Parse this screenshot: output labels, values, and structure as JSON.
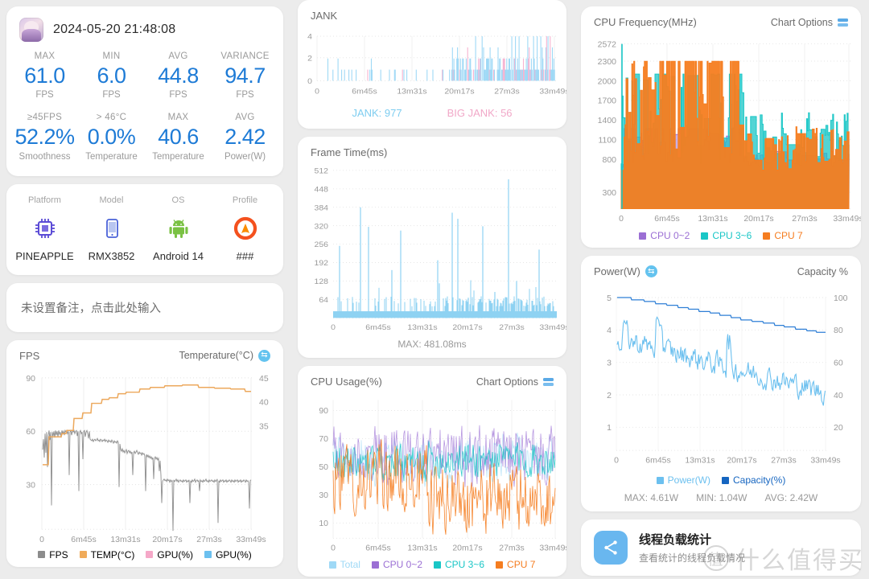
{
  "summary": {
    "date": "2024-05-20 21:48:08",
    "app_icon": "game-app-icon",
    "row1": [
      {
        "top": "MAX",
        "value": "61.0",
        "unit": "FPS"
      },
      {
        "top": "MIN",
        "value": "6.0",
        "unit": "FPS"
      },
      {
        "top": "AVG",
        "value": "44.8",
        "unit": "FPS"
      },
      {
        "top": "VARIANCE",
        "value": "94.7",
        "unit": "FPS"
      }
    ],
    "row2": [
      {
        "top": "≥45FPS",
        "value": "52.2%",
        "unit": "Smoothness"
      },
      {
        "top": "> 46°C",
        "value": "0.0%",
        "unit": "Temperature"
      },
      {
        "top": "MAX",
        "value": "40.6",
        "unit": "Temperature"
      },
      {
        "top": "AVG",
        "value": "2.42",
        "unit": "Power(W)"
      }
    ]
  },
  "device": [
    {
      "label": "Platform",
      "name": "PINEAPPLE",
      "icon": "cpu-chip-icon"
    },
    {
      "label": "Model",
      "name": "RMX3852",
      "icon": "phone-icon"
    },
    {
      "label": "OS",
      "name": "Android 14",
      "icon": "android-icon"
    },
    {
      "label": "Profile",
      "name": "###",
      "icon": "profile-flame-icon"
    }
  ],
  "note": {
    "placeholder": "未设置备注，点击此处输入"
  },
  "colors": {
    "accent_blue": "#1e7bd6",
    "light_blue": "#8ed2f2",
    "pink": "#f5a8c8",
    "purple": "#9b6fd4",
    "teal": "#19c6c6",
    "orange": "#f57d20",
    "orange_light": "#f0ab5a",
    "gray_line": "#8c8c8c",
    "dark_blue": "#1565c0"
  },
  "chart_data": [
    {
      "id": "jank",
      "type": "bar",
      "title": "JANK",
      "ylabel": "",
      "xlabel": "",
      "yticks": [
        0,
        2,
        4
      ],
      "ylim": [
        0,
        4.4
      ],
      "xticks": [
        "0",
        "6m45s",
        "13m31s",
        "20m17s",
        "27m3s",
        "33m49s"
      ],
      "xlim": [
        0,
        2029
      ],
      "grid": true,
      "series": [
        {
          "name": "JANK",
          "color": "#9fd9f6",
          "summary_label": "JANK: 977",
          "value": 977
        },
        {
          "name": "BIG JANK",
          "color": "#f7b3d0",
          "summary_label": "BIG JANK: 56",
          "value": 56
        }
      ],
      "notes": "Sparse low jank bars before ~17m, dense 1-4 jank bars after ~17m"
    },
    {
      "id": "frame_time",
      "type": "bar",
      "title": "Frame Time(ms)",
      "yticks": [
        64,
        128,
        192,
        256,
        320,
        384,
        448,
        512
      ],
      "ylim": [
        0,
        512
      ],
      "xticks": [
        "0",
        "6m45s",
        "13m31s",
        "20m17s",
        "27m3s",
        "33m49s"
      ],
      "grid": true,
      "series": [
        {
          "name": "Frame Time",
          "color": "#8ed2f2"
        }
      ],
      "footer": "MAX: 481.08ms",
      "peaks": [
        250,
        384,
        316,
        303,
        166,
        200,
        365,
        344,
        318,
        481,
        237
      ],
      "baseline": 30
    },
    {
      "id": "cpu_usage",
      "type": "line",
      "title": "CPU Usage(%)",
      "options_label": "Chart Options",
      "yticks": [
        10,
        30,
        50,
        70,
        90
      ],
      "ylim": [
        0,
        100
      ],
      "xticks": [
        "0",
        "6m45s",
        "13m31s",
        "20m17s",
        "27m3s",
        "33m49s"
      ],
      "grid": true,
      "series": [
        {
          "name": "Total",
          "color": "#9fd9f6"
        },
        {
          "name": "CPU 0~2",
          "color": "#9b6fd4"
        },
        {
          "name": "CPU 3~6",
          "color": "#19c6c6"
        },
        {
          "name": "CPU 7",
          "color": "#f57d20"
        }
      ]
    },
    {
      "id": "cpu_freq",
      "type": "line",
      "title": "CPU Frequency(MHz)",
      "options_label": "Chart Options",
      "yticks": [
        300,
        800,
        1100,
        1400,
        1700,
        2000,
        2300,
        2572
      ],
      "ylim": [
        0,
        2572
      ],
      "xticks": [
        "0",
        "6m45s",
        "13m31s",
        "20m17s",
        "27m3s",
        "33m49s"
      ],
      "grid": true,
      "series": [
        {
          "name": "CPU 0~2",
          "color": "#9b6fd4"
        },
        {
          "name": "CPU 3~6",
          "color": "#19c6c6"
        },
        {
          "name": "CPU 7",
          "color": "#f57d20"
        }
      ]
    },
    {
      "id": "power",
      "type": "line",
      "title": "Power(W)",
      "right_title": "Capacity %",
      "yticks": [
        1,
        2,
        3,
        4,
        5
      ],
      "ylim": [
        0,
        5.3
      ],
      "y2ticks": [
        20,
        40,
        60,
        80,
        100
      ],
      "y2lim": [
        0,
        106
      ],
      "xticks": [
        "0",
        "6m45s",
        "13m31s",
        "20m17s",
        "27m3s",
        "33m49s"
      ],
      "grid": true,
      "series": [
        {
          "name": "Power(W)",
          "color": "#6cc0ef"
        },
        {
          "name": "Capacity(%)",
          "color": "#1565c0"
        }
      ],
      "footer": [
        "MAX: 4.61W",
        "MIN: 1.04W",
        "AVG: 2.42W"
      ]
    },
    {
      "id": "fps_temp",
      "type": "line",
      "title": "FPS",
      "right_title": "Temperature(°C)",
      "yticks": [
        30,
        60,
        90
      ],
      "ylim": [
        0,
        96
      ],
      "y2ticks": [
        35,
        40,
        45
      ],
      "y2lim": [
        20,
        48
      ],
      "xticks": [
        "0",
        "6m45s",
        "13m31s",
        "20m17s",
        "27m3s",
        "33m49s"
      ],
      "grid": true,
      "series": [
        {
          "name": "FPS",
          "color": "#8c8c8c"
        },
        {
          "name": "TEMP(°C)",
          "color": "#f0ab5a"
        },
        {
          "name": "GPU(%)",
          "color": "#f5a8c8"
        },
        {
          "name": "GPU(%)",
          "color": "#6cc0ef"
        }
      ]
    }
  ],
  "thread_card": {
    "title": "线程负载统计",
    "subtitle": "查看统计的线程负载情况",
    "icon": "share-nodes-icon"
  },
  "watermark": {
    "mark": "值",
    "text": "什么值得买"
  }
}
